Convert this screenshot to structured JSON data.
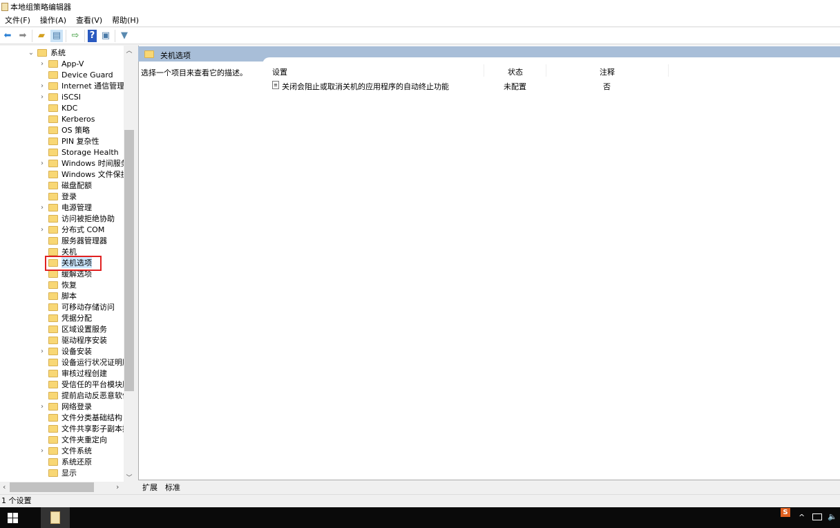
{
  "window": {
    "title": "本地组策略编辑器"
  },
  "menu": [
    "文件(F)",
    "操作(A)",
    "查看(V)",
    "帮助(H)"
  ],
  "toolbar": [
    "back-icon",
    "forward-icon",
    "up-folder-icon",
    "show-hide-tree-icon",
    "export-icon",
    "help-icon",
    "properties-icon",
    "filter-icon"
  ],
  "tree": {
    "parent": "系统",
    "items": [
      {
        "label": "App-V",
        "expandable": true
      },
      {
        "label": "Device Guard",
        "expandable": false
      },
      {
        "label": "Internet 通信管理",
        "expandable": true
      },
      {
        "label": "iSCSI",
        "expandable": true
      },
      {
        "label": "KDC",
        "expandable": false
      },
      {
        "label": "Kerberos",
        "expandable": false
      },
      {
        "label": "OS 策略",
        "expandable": false
      },
      {
        "label": "PIN 复杂性",
        "expandable": false
      },
      {
        "label": "Storage Health",
        "expandable": false
      },
      {
        "label": "Windows 时间服务",
        "expandable": true
      },
      {
        "label": "Windows 文件保护",
        "expandable": false
      },
      {
        "label": "磁盘配额",
        "expandable": false
      },
      {
        "label": "登录",
        "expandable": false
      },
      {
        "label": "电源管理",
        "expandable": true
      },
      {
        "label": "访问被拒绝协助",
        "expandable": false
      },
      {
        "label": "分布式 COM",
        "expandable": true
      },
      {
        "label": "服务器管理器",
        "expandable": false
      },
      {
        "label": "关机",
        "expandable": false
      },
      {
        "label": "关机选项",
        "expandable": false,
        "selected": true
      },
      {
        "label": "缓解选项",
        "expandable": false
      },
      {
        "label": "恢复",
        "expandable": false
      },
      {
        "label": "脚本",
        "expandable": false
      },
      {
        "label": "可移动存储访问",
        "expandable": false
      },
      {
        "label": "凭据分配",
        "expandable": false
      },
      {
        "label": "区域设置服务",
        "expandable": false
      },
      {
        "label": "驱动程序安装",
        "expandable": false
      },
      {
        "label": "设备安装",
        "expandable": true
      },
      {
        "label": "设备运行状况证明服务",
        "expandable": false
      },
      {
        "label": "审核过程创建",
        "expandable": false
      },
      {
        "label": "受信任的平台模块服务",
        "expandable": false
      },
      {
        "label": "提前启动反恶意软件",
        "expandable": false
      },
      {
        "label": "网络登录",
        "expandable": true
      },
      {
        "label": "文件分类基础结构",
        "expandable": false
      },
      {
        "label": "文件共享影子副本提供程序",
        "expandable": false
      },
      {
        "label": "文件夹重定向",
        "expandable": false
      },
      {
        "label": "文件系统",
        "expandable": true
      },
      {
        "label": "系统还原",
        "expandable": false
      },
      {
        "label": "显示",
        "expandable": false
      }
    ]
  },
  "panel": {
    "title": "关机选项",
    "description": "选择一个项目来查看它的描述。",
    "columns": [
      "设置",
      "状态",
      "注释"
    ],
    "rows": [
      {
        "setting": "关闭会阻止或取消关机的应用程序的自动终止功能",
        "state": "未配置",
        "comment": "否"
      }
    ]
  },
  "tabs": [
    "扩展",
    "标准"
  ],
  "status": "1 个设置",
  "colors": {
    "highlight": "#e02020",
    "selection": "#cce8ff",
    "header_band": "#a8bed8"
  }
}
